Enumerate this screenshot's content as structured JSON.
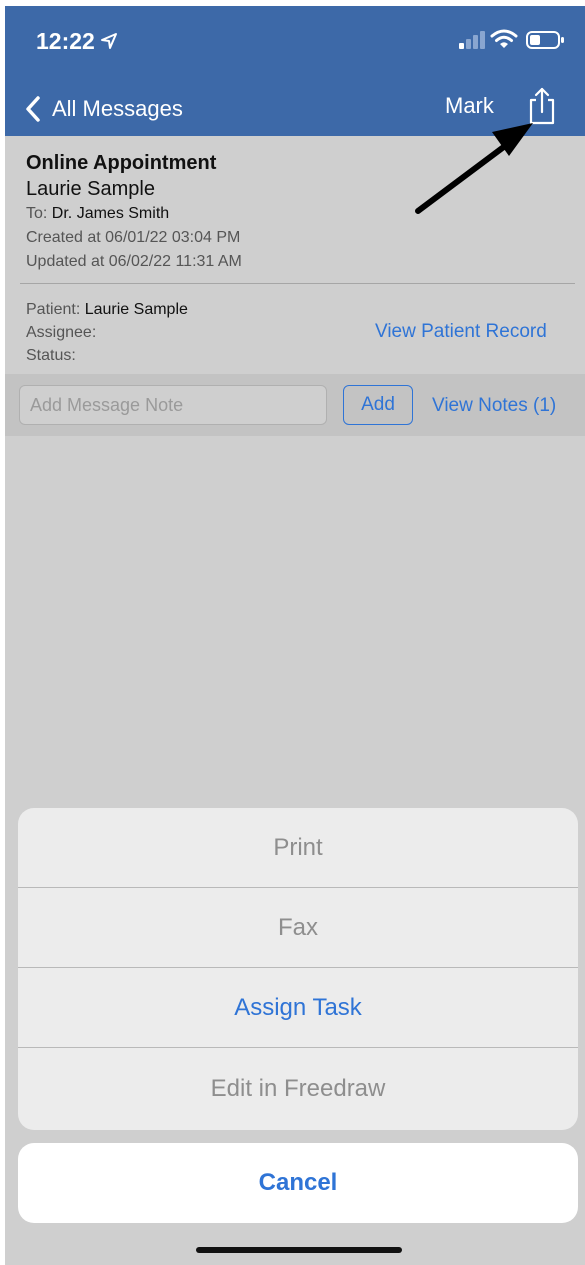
{
  "status_bar": {
    "time": "12:22"
  },
  "nav": {
    "back_label": "All Messages",
    "mark_label": "Mark"
  },
  "message": {
    "title": "Online Appointment",
    "sender": "Laurie Sample",
    "to_label": "To:",
    "to_value": "Dr. James Smith",
    "created": "Created at 06/01/22 03:04 PM",
    "updated": "Updated at 06/02/22 11:31 AM"
  },
  "info": {
    "patient_label": "Patient:",
    "patient_value": "Laurie Sample",
    "assignee_label": "Assignee:",
    "status_label": "Status:",
    "view_record": "View Patient Record"
  },
  "notes": {
    "placeholder": "Add Message Note",
    "add_label": "Add",
    "view_notes": "View Notes (1)"
  },
  "sheet": {
    "items": [
      {
        "label": "Print"
      },
      {
        "label": "Fax"
      },
      {
        "label": "Assign Task"
      },
      {
        "label": "Edit in Freedraw"
      }
    ],
    "cancel_label": "Cancel"
  },
  "colors": {
    "nav_bar": "#3d69a8",
    "link": "#2f74d6",
    "background": "#cfcfcf"
  }
}
